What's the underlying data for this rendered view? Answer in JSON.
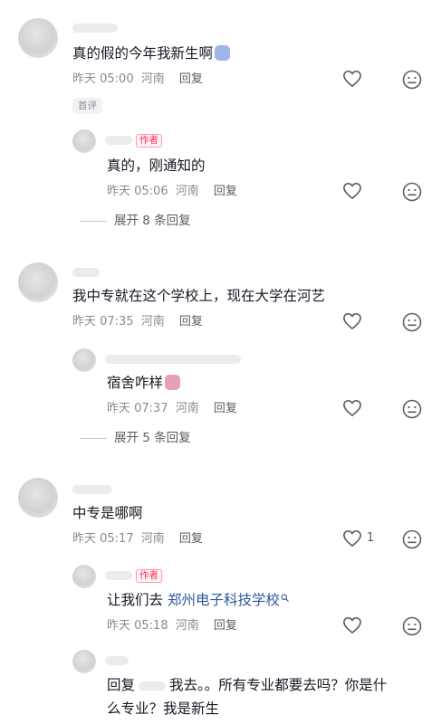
{
  "comments": [
    {
      "text": "真的假的今年我新生啊",
      "time": "昨天 05:00",
      "location": "河南",
      "reply_label": "回复",
      "badge": "首评",
      "replies": [
        {
          "author_tag": "作者",
          "text": "真的，刚通知的",
          "time": "昨天 05:06",
          "location": "河南",
          "reply_label": "回复"
        }
      ],
      "expand_label": "展开 8 条回复"
    },
    {
      "text": "我中专就在这个学校上，现在大学在河艺",
      "time": "昨天 07:35",
      "location": "河南",
      "reply_label": "回复",
      "replies": [
        {
          "text": "宿舍咋样",
          "time": "昨天 07:37",
          "location": "河南",
          "reply_label": "回复"
        }
      ],
      "expand_label": "展开 5 条回复"
    },
    {
      "text": "中专是哪啊",
      "time": "昨天 05:17",
      "location": "河南",
      "reply_label": "回复",
      "like_count": "1",
      "replies": [
        {
          "author_tag": "作者",
          "text_prefix": "让我们去",
          "link_text": "郑州电子科技学校",
          "time": "昨天 05:18",
          "location": "河南",
          "reply_label": "回复"
        },
        {
          "line1_reply": "回复",
          "line1_rest": "我去。。所有专业都要去吗？你是什",
          "line2": "么专业？我是新生"
        }
      ]
    }
  ],
  "icons": {
    "like": "heart-outline-icon",
    "dislike": "meh-face-icon",
    "search": "search-link-icon"
  },
  "colors": {
    "author_tag": "#fe2c55",
    "link": "#2e5a9e",
    "meta": "#8a8b91"
  }
}
